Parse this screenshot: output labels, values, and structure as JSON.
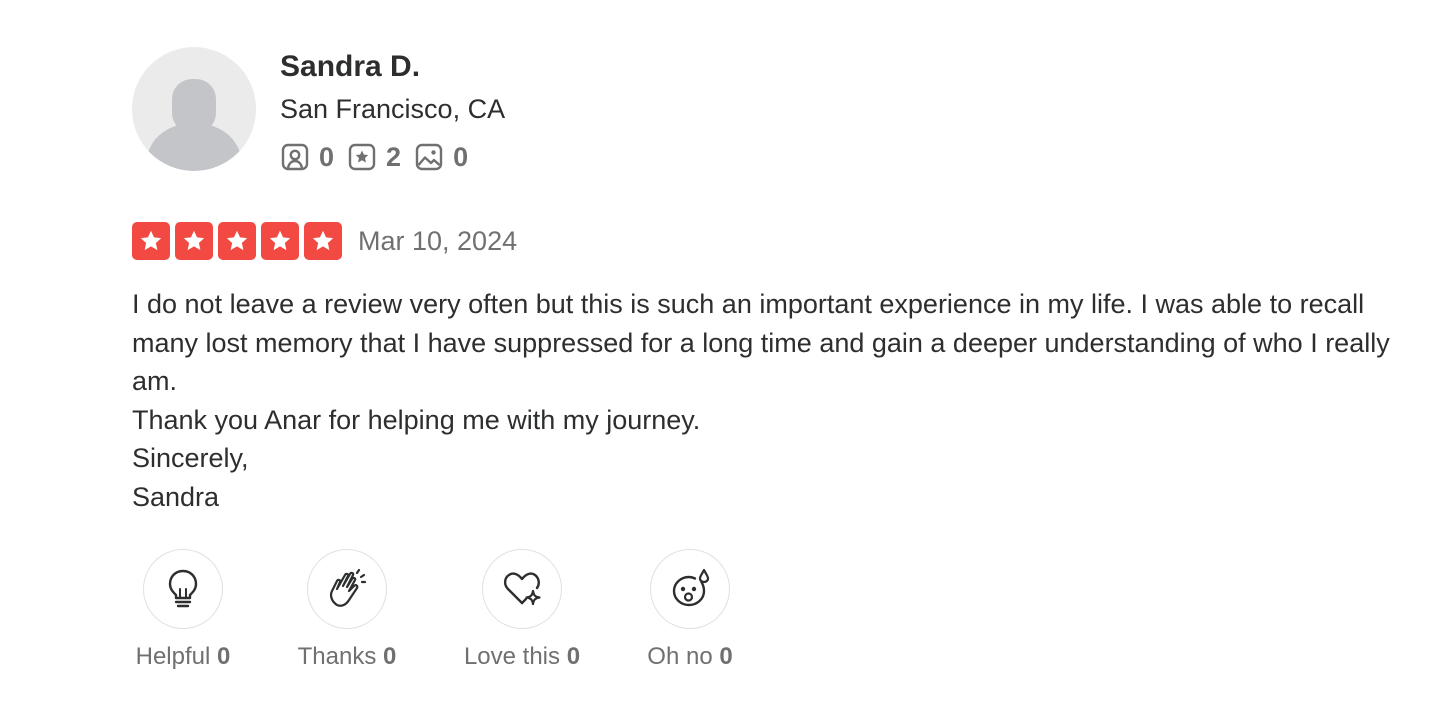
{
  "reviewer": {
    "name": "Sandra D.",
    "location": "San Francisco, CA",
    "stats": [
      {
        "icon": "friends-icon",
        "count": "0"
      },
      {
        "icon": "reviews-star-icon",
        "count": "2"
      },
      {
        "icon": "photos-icon",
        "count": "0"
      }
    ]
  },
  "review": {
    "rating": 5,
    "rating_max": 5,
    "star_color": "#f24a42",
    "date": "Mar 10, 2024",
    "paragraphs": [
      "I do not leave a review very often but this is such an important experience in my life. I was able to recall many lost memory that I have suppressed for a long time and gain a deeper understanding of who I really am.",
      "Thank you Anar for helping me with my journey.",
      "Sincerely,",
      "Sandra"
    ]
  },
  "reactions": [
    {
      "label": "Helpful",
      "count": "0",
      "icon": "lightbulb-icon"
    },
    {
      "label": "Thanks",
      "count": "0",
      "icon": "clapping-hands-icon"
    },
    {
      "label": "Love this",
      "count": "0",
      "icon": "heart-sparkle-icon"
    },
    {
      "label": "Oh no",
      "count": "0",
      "icon": "surprised-face-icon"
    }
  ]
}
